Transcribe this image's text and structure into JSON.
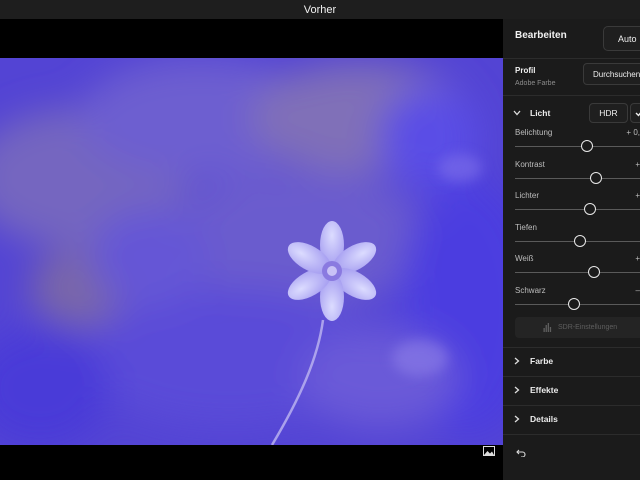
{
  "window": {
    "title": "Vorher"
  },
  "panel": {
    "title": "Bearbeiten",
    "auto_label": "Auto",
    "profile": {
      "label": "Profil",
      "value": "Adobe Farbe",
      "browse_label": "Durchsuchen"
    },
    "light_section": {
      "label": "Licht",
      "expanded": true,
      "hdr_label": "HDR",
      "check_icon": "checkmark-icon",
      "sliders": [
        {
          "label": "Belichtung",
          "value": "+ 0,",
          "level": 0.55
        },
        {
          "label": "Kontrast",
          "value": "+",
          "level": 0.62
        },
        {
          "label": "Lichter",
          "value": "+",
          "level": 0.58
        },
        {
          "label": "Tiefen",
          "value": "",
          "level": 0.5
        },
        {
          "label": "Weiß",
          "value": "+",
          "level": 0.61
        },
        {
          "label": "Schwarz",
          "value": "–",
          "level": 0.45
        }
      ],
      "sdr_label": "SDR-Einstellungen"
    },
    "sections": [
      {
        "label": "Farbe"
      },
      {
        "label": "Effekte"
      },
      {
        "label": "Details"
      }
    ],
    "undo_icon": "undo-icon"
  },
  "canvas": {
    "compare_icon": "before-after-icon"
  },
  "colors": {
    "accent": "#5a49e0",
    "panel_bg": "#1b1b1b",
    "titlebar_bg": "#1e1e1e"
  }
}
